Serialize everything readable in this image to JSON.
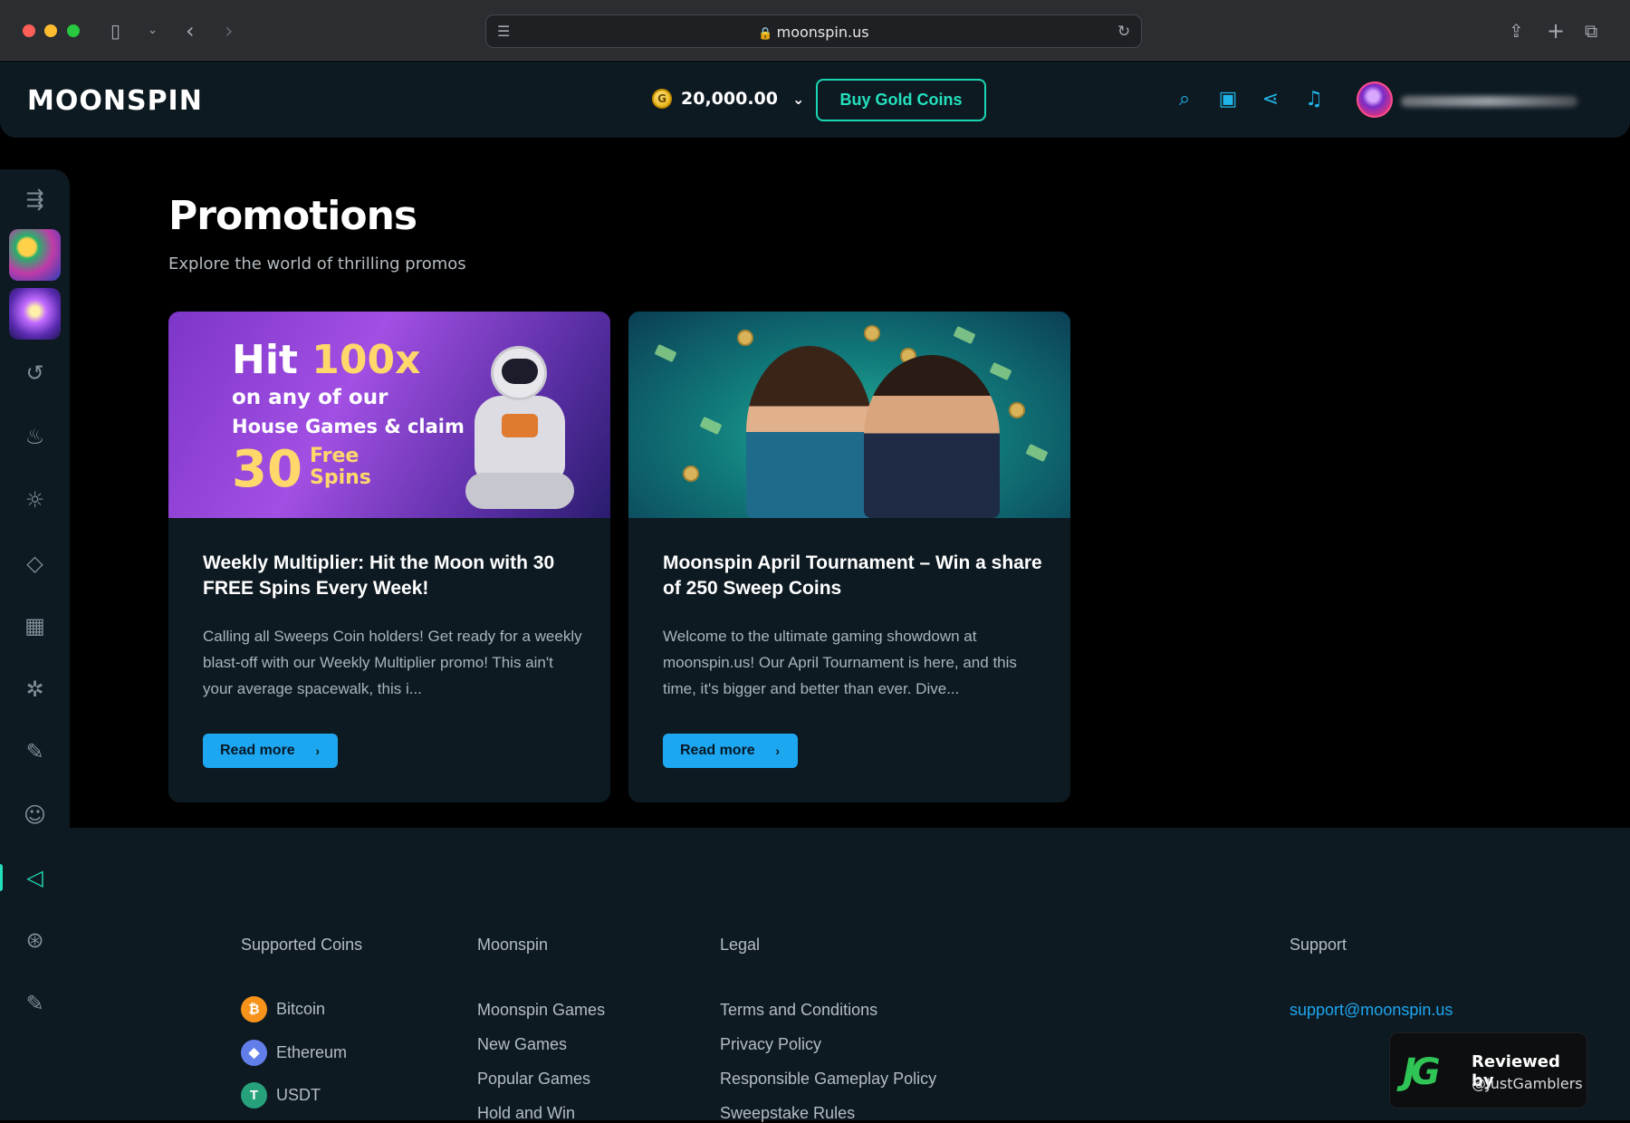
{
  "browser": {
    "url": "moonspin.us"
  },
  "header": {
    "logo": "MOONSPIN",
    "balance": "20,000.00",
    "coin_symbol": "G",
    "buy_label": "Buy Gold Coins",
    "accent_color": "#23e0bd",
    "icons": [
      "search-icon",
      "treasure-icon",
      "share-icon",
      "bell-icon"
    ]
  },
  "sidebar": {
    "items": [
      "menu-toggle-icon",
      "recent-icon",
      "fire-icon",
      "sun-icon",
      "diamond-icon",
      "slot-machine-icon",
      "gear-cluster-icon",
      "checklist-icon",
      "user-icon",
      "megaphone-icon",
      "support-icon",
      "checklist-icon"
    ],
    "active": "megaphone-icon"
  },
  "main": {
    "title": "Promotions",
    "subtitle": "Explore the world of thrilling promos",
    "cards": [
      {
        "banner": {
          "hit": "Hit",
          "multiplier": "100x",
          "line1": "on any of our",
          "line2": "House Games & claim",
          "free_count": "30",
          "free_label1": "Free",
          "free_label2": "Spins"
        },
        "title": "Weekly Multiplier: Hit the Moon with 30 FREE Spins Every Week!",
        "description": "Calling all Sweeps Coin holders! Get ready for a weekly blast-off with our Weekly Multiplier promo! This ain't your average spacewalk, this i...",
        "button": "Read more"
      },
      {
        "title": "Moonspin April Tournament – Win a share of 250 Sweep Coins",
        "description": "Welcome to the ultimate gaming showdown at moonspin.us! Our April Tournament is here, and this time, it's bigger and better than ever. Dive...",
        "button": "Read more"
      }
    ]
  },
  "footer": {
    "supported_coins": {
      "heading": "Supported Coins",
      "coins": [
        {
          "name": "Bitcoin",
          "symbol": "₿",
          "color": "#f7931a"
        },
        {
          "name": "Ethereum",
          "symbol": "◆",
          "color": "#627eea"
        },
        {
          "name": "USDT",
          "symbol": "T",
          "color": "#26a17b"
        }
      ]
    },
    "moonspin": {
      "heading": "Moonspin",
      "links": [
        "Moonspin Games",
        "New Games",
        "Popular Games",
        "Hold and Win"
      ]
    },
    "legal": {
      "heading": "Legal",
      "links": [
        "Terms and Conditions",
        "Privacy Policy",
        "Responsible Gameplay Policy",
        "Sweepstake Rules"
      ]
    },
    "support": {
      "heading": "Support",
      "email": "support@moonspin.us"
    }
  },
  "badge": {
    "logo": "JG",
    "line1": "Reviewed by",
    "line2": "@JustGamblers"
  }
}
